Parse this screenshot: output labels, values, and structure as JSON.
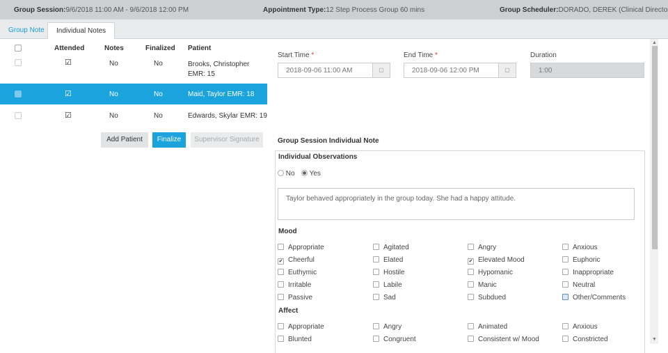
{
  "header": {
    "group_session_label": "Group Session:",
    "group_session_value": "9/6/2018 11:00 AM - 9/6/2018 12:00 PM",
    "appointment_type_label": "Appointment Type:",
    "appointment_type_value": "12 Step Process Group 60 mins",
    "scheduler_label": "Group Scheduler:",
    "scheduler_value": "DORADO, DEREK (Clinical Director)"
  },
  "tabs": [
    {
      "label": "Group Note"
    },
    {
      "label": "Individual Notes"
    }
  ],
  "table": {
    "columns": [
      "Attended",
      "Notes",
      "Finalized",
      "Patient"
    ],
    "rows": [
      {
        "notes": "No",
        "finalized": "No",
        "patient": "Brooks, Christopher EMR: 15",
        "selected": false
      },
      {
        "notes": "No",
        "finalized": "No",
        "patient": "Maid, Taylor EMR: 18",
        "selected": true
      },
      {
        "notes": "No",
        "finalized": "No",
        "patient": "Edwards, Skylar EMR: 19",
        "selected": false
      }
    ]
  },
  "buttons": {
    "add_patient": "Add Patient",
    "finalize": "Finalize",
    "supervisor_signature": "Supervisor Signature"
  },
  "form": {
    "start_time_label": "Start Time",
    "start_time_value": "2018-09-06 11:00 AM",
    "end_time_label": "End Time",
    "end_time_value": "2018-09-06 12:00 PM",
    "duration_label": "Duration",
    "duration_value": "1:00",
    "required_mark": "*",
    "section_title": "Group Session Individual Note",
    "observations_title": "Individual Observations",
    "radio_no": "No",
    "radio_yes": "Yes",
    "note_text": "Taylor behaved appropriately in the group today. She had a happy attitude.",
    "mood_title": "Mood",
    "mood_options": [
      [
        "Appropriate",
        "Agitated",
        "Angry",
        "Anxious"
      ],
      [
        "Cheerful",
        "Elated",
        "Elevated Mood",
        "Euphoric"
      ],
      [
        "Euthymic",
        "Hostile",
        "Hypomanic",
        "Inappropriate"
      ],
      [
        "Irritable",
        "Labile",
        "Manic",
        "Neutral"
      ],
      [
        "Passive",
        "Sad",
        "Subdued",
        "Other/Comments"
      ]
    ],
    "affect_title": "Affect",
    "affect_options": [
      [
        "Appropriate",
        "Angry",
        "Animated",
        "Anxious"
      ],
      [
        "Blunted",
        "Congruent",
        "Consistent w/ Mood",
        "Constricted"
      ]
    ]
  }
}
